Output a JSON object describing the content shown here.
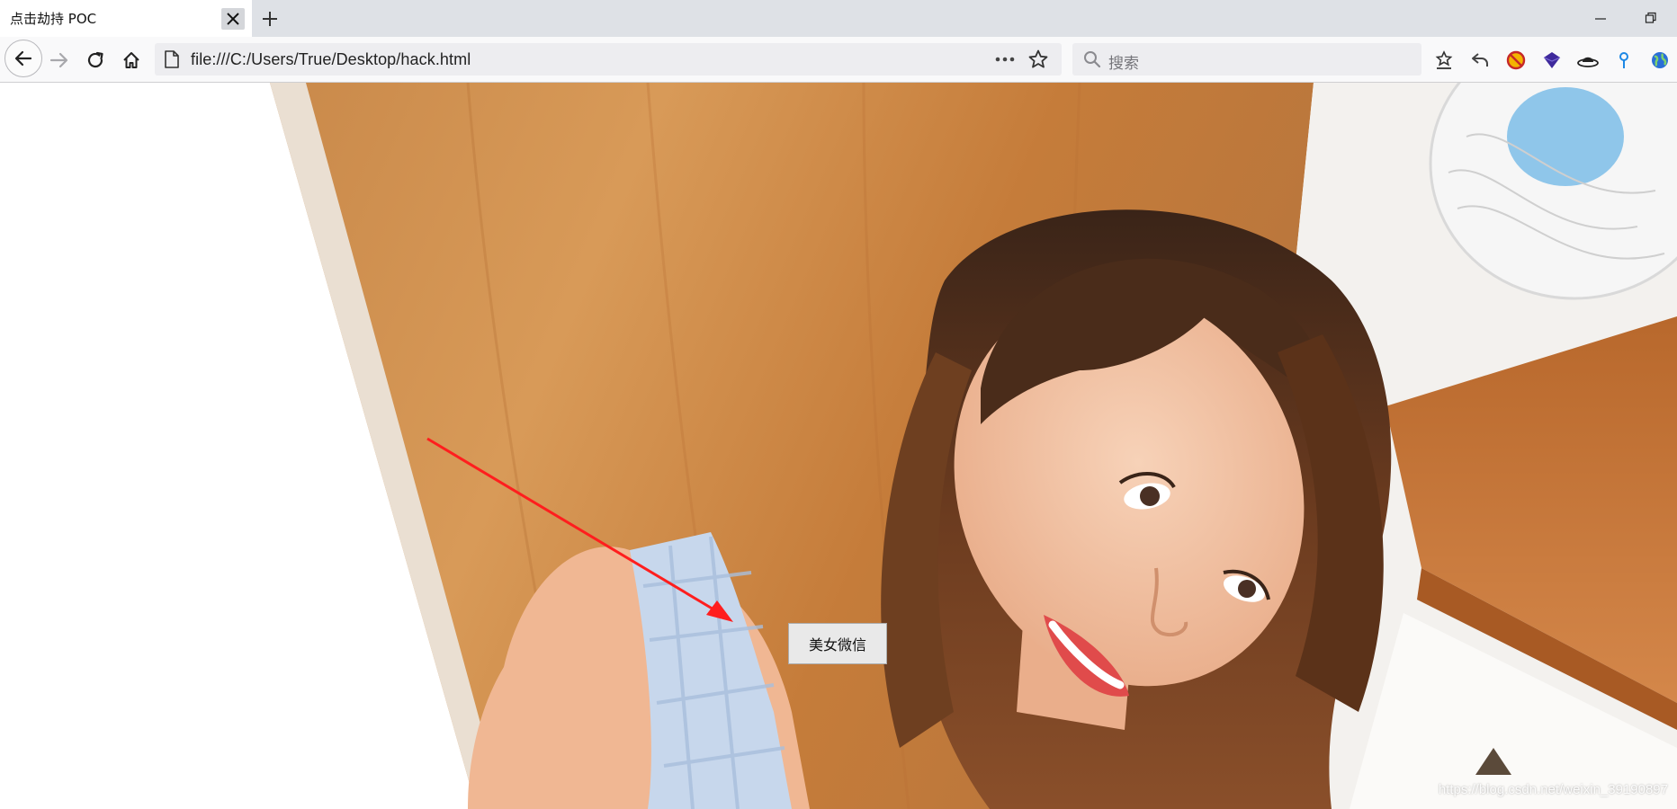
{
  "tab": {
    "title": "点击劫持 POC",
    "close_icon": "close-icon",
    "new_tab_icon": "plus-icon"
  },
  "window": {
    "minimize_icon": "minimize-icon",
    "restore_icon": "restore-icon"
  },
  "toolbar": {
    "back_icon": "arrow-left-icon",
    "forward_icon": "arrow-right-icon",
    "reload_icon": "reload-icon",
    "home_icon": "home-icon",
    "url": "file:///C:/Users/True/Desktop/hack.html",
    "page_icon": "file-icon",
    "page_actions_icon": "more-horizontal-icon",
    "bookmark_icon": "star-icon",
    "search_placeholder": "搜索",
    "extensions": [
      "bookmarks-icon",
      "undo-icon",
      "no-script-icon",
      "cube-icon",
      "hat-icon",
      "location-pin-icon",
      "globe-icon"
    ]
  },
  "page": {
    "button_label": "美女微信",
    "watermark": "https://blog.csdn.net/weixin_39190897"
  },
  "colors": {
    "arrow": "#ff1e1e",
    "wood": "#d08a42",
    "wall": "#f3f1ee"
  }
}
